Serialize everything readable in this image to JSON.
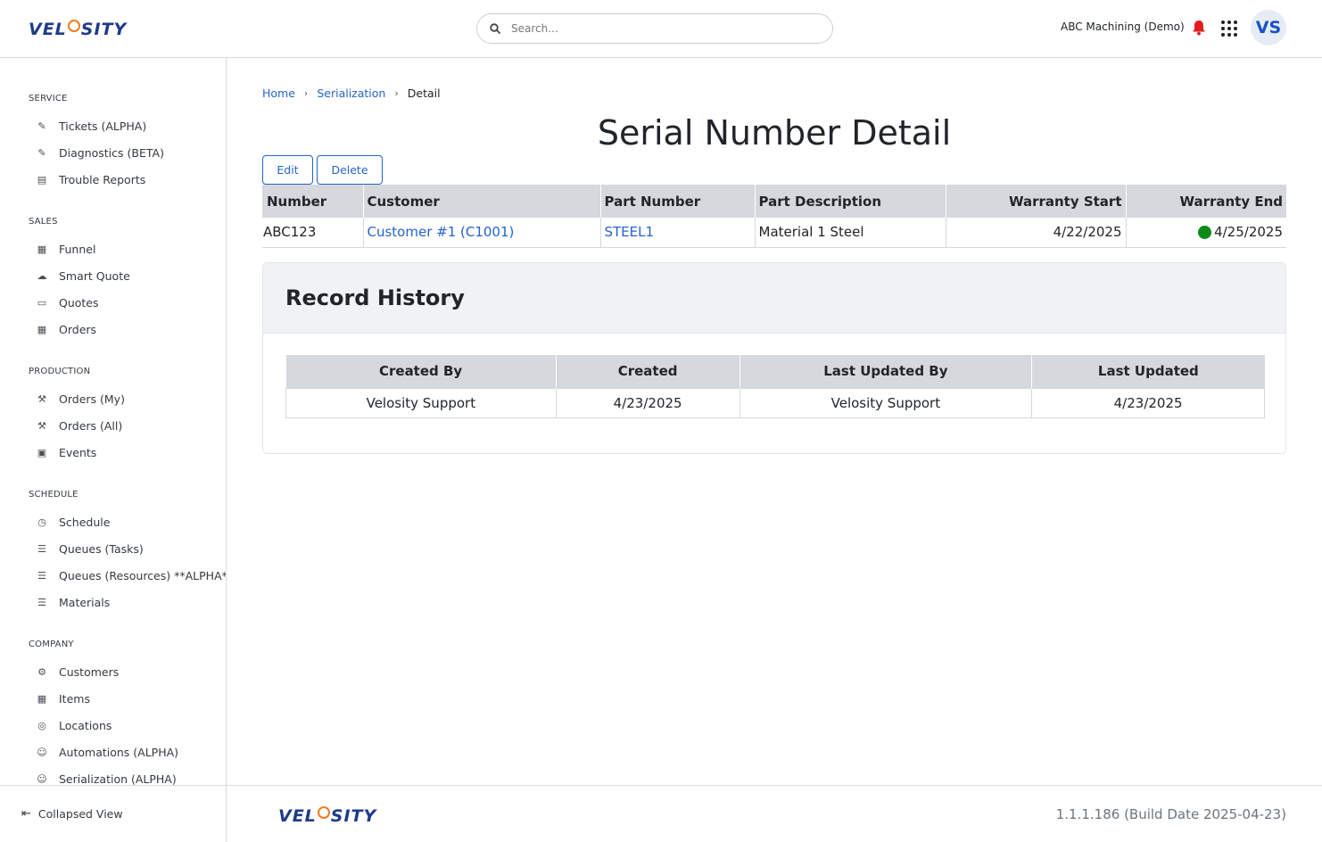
{
  "header": {
    "logo_text_a": "VEL",
    "logo_text_b": "SITY",
    "search_placeholder": "Search...",
    "org_name": "ABC Machining (Demo)",
    "avatar_initials": "VS",
    "colors": {
      "primary": "#2563c9",
      "logo_blue": "#1f3a8a",
      "logo_orange": "#f07c1e",
      "alert": "#e11d1d"
    }
  },
  "sidebar": {
    "sections": [
      {
        "title": "SERVICE",
        "items": [
          {
            "label": "Tickets (ALPHA)",
            "icon": "wrench-icon"
          },
          {
            "label": "Diagnostics (BETA)",
            "icon": "wrench-icon"
          },
          {
            "label": "Trouble Reports",
            "icon": "inbox-icon"
          }
        ]
      },
      {
        "title": "SALES",
        "items": [
          {
            "label": "Funnel",
            "icon": "building-icon"
          },
          {
            "label": "Smart Quote",
            "icon": "cloud-icon"
          },
          {
            "label": "Quotes",
            "icon": "ticket-icon"
          },
          {
            "label": "Orders",
            "icon": "grid-icon"
          }
        ]
      },
      {
        "title": "PRODUCTION",
        "items": [
          {
            "label": "Orders (My)",
            "icon": "robot-arm-icon"
          },
          {
            "label": "Orders (All)",
            "icon": "robot-arm-icon"
          },
          {
            "label": "Events",
            "icon": "calendar-icon"
          }
        ]
      },
      {
        "title": "SCHEDULE",
        "items": [
          {
            "label": "Schedule",
            "icon": "clock-icon"
          },
          {
            "label": "Queues (Tasks)",
            "icon": "list-icon"
          },
          {
            "label": "Queues (Resources) **ALPHA**",
            "icon": "list-icon"
          },
          {
            "label": "Materials",
            "icon": "list-icon"
          }
        ]
      },
      {
        "title": "COMPANY",
        "items": [
          {
            "label": "Customers",
            "icon": "gear-icon"
          },
          {
            "label": "Items",
            "icon": "grid-icon"
          },
          {
            "label": "Locations",
            "icon": "pin-icon"
          },
          {
            "label": "Automations (ALPHA)",
            "icon": "robot-icon"
          },
          {
            "label": "Serialization (ALPHA)",
            "icon": "robot-icon"
          }
        ]
      }
    ],
    "collapse_label": "Collapsed View"
  },
  "breadcrumb": {
    "home": "Home",
    "section": "Serialization",
    "current": "Detail"
  },
  "page_title": "Serial Number Detail",
  "actions": {
    "edit": "Edit",
    "delete": "Delete"
  },
  "detail_table": {
    "headers": [
      "Number",
      "Customer",
      "Part Number",
      "Part Description",
      "Warranty Start",
      "Warranty End"
    ],
    "row": {
      "number": "ABC123",
      "customer": "Customer #1 (C1001)",
      "part_number": "STEEL1",
      "part_description": "Material 1 Steel",
      "warranty_start": "4/22/2025",
      "warranty_end": "4/25/2025",
      "status_color": "#0c8a17"
    }
  },
  "record_history": {
    "title": "Record History",
    "headers": [
      "Created By",
      "Created",
      "Last Updated By",
      "Last Updated"
    ],
    "row": {
      "created_by": "Velosity Support",
      "created": "4/23/2025",
      "updated_by": "Velosity Support",
      "updated": "4/23/2025"
    }
  },
  "footer": {
    "version": "1.1.1.186 (Build Date 2025-04-23)"
  }
}
